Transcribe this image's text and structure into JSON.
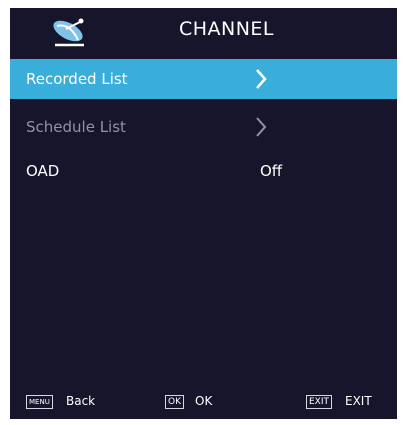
{
  "header": {
    "title": "CHANNEL",
    "icon": "satellite-dish-icon",
    "icon_color": "#7fc4e8"
  },
  "menu": {
    "items": [
      {
        "label": "Recorded List",
        "control": "chevron-right-icon",
        "selected": true
      },
      {
        "label": "Schedule List",
        "control": "chevron-right-icon",
        "selected": false
      },
      {
        "label": "OAD",
        "value": "Off",
        "selected": false
      }
    ]
  },
  "footer": {
    "menu_key": "MENU",
    "menu_label": "Back",
    "ok_key": "OK",
    "ok_label": "OK",
    "exit_key": "EXIT",
    "exit_label": "EXIT"
  },
  "colors": {
    "background": "#16152c",
    "selected_row": "#3aaedb",
    "dim_text": "#8f93a8"
  }
}
